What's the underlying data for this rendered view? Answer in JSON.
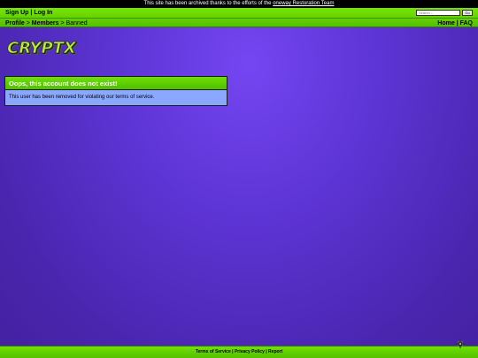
{
  "archive_notice": {
    "before": "This site has been archived thanks to the efforts of the ",
    "link": "oneway Restoration Team"
  },
  "topbar": {
    "signup": "Sign Up",
    "login": "Log In",
    "sep": "|",
    "search_placeholder": "Search...",
    "search_button": "Go",
    "breadcrumb": {
      "profile": "Profile",
      "members": "Members",
      "current": "Banned",
      "arrow": ">"
    },
    "home": "Home",
    "faq": "FAQ"
  },
  "logo": {
    "text": "CRYPTX"
  },
  "panel": {
    "title": "Oops, this account does not exist!",
    "message": "This user has been removed for violating our terms of service."
  },
  "footer": {
    "terms": "Terms of Service",
    "privacy": "Privacy Policy",
    "report": "Report",
    "sep": "|"
  },
  "colors": {
    "topbar_green": "#66d400",
    "panel_body": "#8aa8ff",
    "background_purple": "#5e35d6"
  },
  "icons": {
    "corner": "gear-icon"
  }
}
